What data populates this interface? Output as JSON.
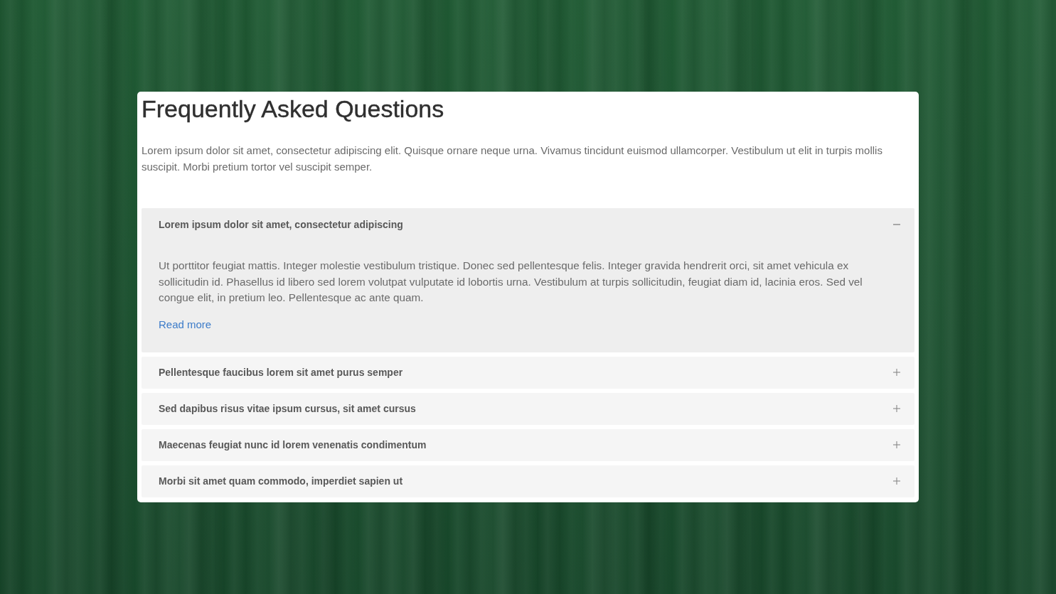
{
  "page": {
    "title": "Frequently Asked Questions",
    "intro": "Lorem ipsum dolor sit amet, consectetur adipiscing elit. Quisque ornare neque urna. Vivamus tincidunt euismod ullamcorper. Vestibulum ut elit in turpis mollis suscipit. Morbi pretium tortor vel suscipit semper."
  },
  "faq": [
    {
      "question": "Lorem ipsum dolor sit amet, consectetur adipiscing",
      "expanded": true,
      "answer": "Ut porttitor feugiat mattis. Integer molestie vestibulum tristique. Donec sed pellentesque felis. Integer gravida hendrerit orci, sit amet vehicula ex sollicitudin id. Phasellus id libero sed lorem volutpat vulputate id lobortis urna. Vestibulum at turpis sollicitudin, feugiat diam id, lacinia eros. Sed vel congue elit, in pretium leo. Pellentesque ac ante quam.",
      "link": "Read more"
    },
    {
      "question": "Pellentesque faucibus lorem sit amet purus semper",
      "expanded": false
    },
    {
      "question": "Sed dapibus risus vitae ipsum cursus, sit amet cursus",
      "expanded": false
    },
    {
      "question": "Maecenas feugiat nunc id lorem venenatis condimentum",
      "expanded": false
    },
    {
      "question": "Morbi sit amet quam commodo, imperdiet sapien ut",
      "expanded": false
    }
  ]
}
